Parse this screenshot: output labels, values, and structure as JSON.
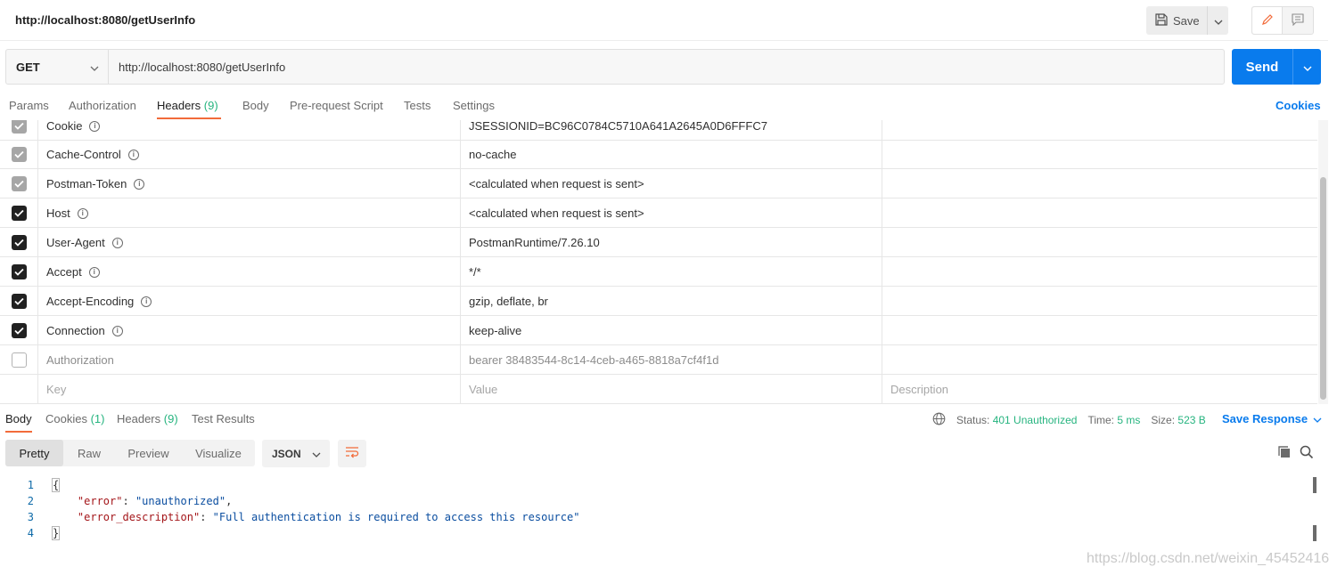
{
  "window": {
    "title": "http://localhost:8080/getUserInfo"
  },
  "toolbar": {
    "save_label": "Save"
  },
  "request": {
    "method": "GET",
    "url": "http://localhost:8080/getUserInfo",
    "send_label": "Send"
  },
  "request_tabs": [
    {
      "label": "Params"
    },
    {
      "label": "Authorization"
    },
    {
      "label": "Headers",
      "count": "(9)"
    },
    {
      "label": "Body"
    },
    {
      "label": "Pre-request Script"
    },
    {
      "label": "Tests"
    },
    {
      "label": "Settings"
    }
  ],
  "cookies_link": "Cookies",
  "headers": {
    "rows": [
      {
        "key": "Cookie",
        "value": "JSESSIONID=BC96C0784C5710A641A2645A0D6FFFC7",
        "state": "dim"
      },
      {
        "key": "Cache-Control",
        "value": "no-cache",
        "state": "dim"
      },
      {
        "key": "Postman-Token",
        "value": "<calculated when request is sent>",
        "state": "dim"
      },
      {
        "key": "Host",
        "value": "<calculated when request is sent>",
        "state": "on"
      },
      {
        "key": "User-Agent",
        "value": "PostmanRuntime/7.26.10",
        "state": "on"
      },
      {
        "key": "Accept",
        "value": "*/*",
        "state": "on"
      },
      {
        "key": "Accept-Encoding",
        "value": "gzip, deflate, br",
        "state": "on"
      },
      {
        "key": "Connection",
        "value": "keep-alive",
        "state": "on"
      },
      {
        "key": "Authorization",
        "value": "bearer 38483544-8c14-4ceb-a465-8818a7cf4f1d",
        "state": "off"
      }
    ],
    "new_row": {
      "key_placeholder": "Key",
      "value_placeholder": "Value",
      "description_placeholder": "Description"
    }
  },
  "response_tabs": [
    {
      "label": "Body"
    },
    {
      "label": "Cookies",
      "count": "(1)"
    },
    {
      "label": "Headers",
      "count": "(9)"
    },
    {
      "label": "Test Results"
    }
  ],
  "response_status": {
    "status_label": "Status:",
    "status_value": "401 Unauthorized",
    "time_label": "Time:",
    "time_value": "5 ms",
    "size_label": "Size:",
    "size_value": "523 B",
    "save_response": "Save Response"
  },
  "view_modes": [
    "Pretty",
    "Raw",
    "Preview",
    "Visualize"
  ],
  "format": "JSON",
  "code": {
    "line_numbers": [
      "1",
      "2",
      "3",
      "4"
    ],
    "open_brace": "{",
    "close_brace": "}",
    "pairs": [
      {
        "key": "\"error\"",
        "sep": ": ",
        "value": "\"unauthorized\"",
        "tail": ","
      },
      {
        "key": "\"error_description\"",
        "sep": ": ",
        "value": "\"Full authentication is required to access this resource\"",
        "tail": ""
      }
    ]
  },
  "watermark": "https://blog.csdn.net/weixin_45452416",
  "icons": {
    "save": "save-icon",
    "caret": "chevron-down-icon",
    "edit": "pencil-icon",
    "comment": "comment-icon",
    "info": "info-icon",
    "globe": "globe-icon",
    "wrap": "wrap-lines-icon",
    "copy": "copy-icon",
    "search": "search-icon"
  },
  "colors": {
    "accent": "#097bed",
    "tab_underline": "#f26b3a",
    "count_green": "#26b47f",
    "json_key": "#a4161a",
    "json_string": "#0b4ea0"
  }
}
